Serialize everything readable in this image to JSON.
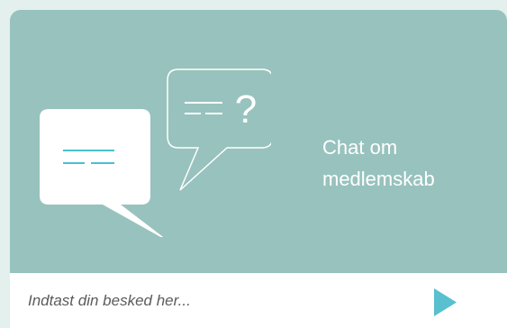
{
  "widget": {
    "title_line_1": "Chat om",
    "title_line_2": "medlemskab",
    "illustration_glyph": "?",
    "illustration_icon": "chat-bubbles-icon",
    "send_icon": "play-triangle-icon"
  },
  "input": {
    "placeholder": "Indtast din besked her...",
    "value": ""
  },
  "colors": {
    "page_background": "#e3f0ee",
    "card_background": "#98c2bd",
    "bubble_line_accent": "#49bfd0",
    "send_button": "#58c0cf",
    "placeholder_text": "#5b5b5b",
    "white": "#ffffff"
  }
}
